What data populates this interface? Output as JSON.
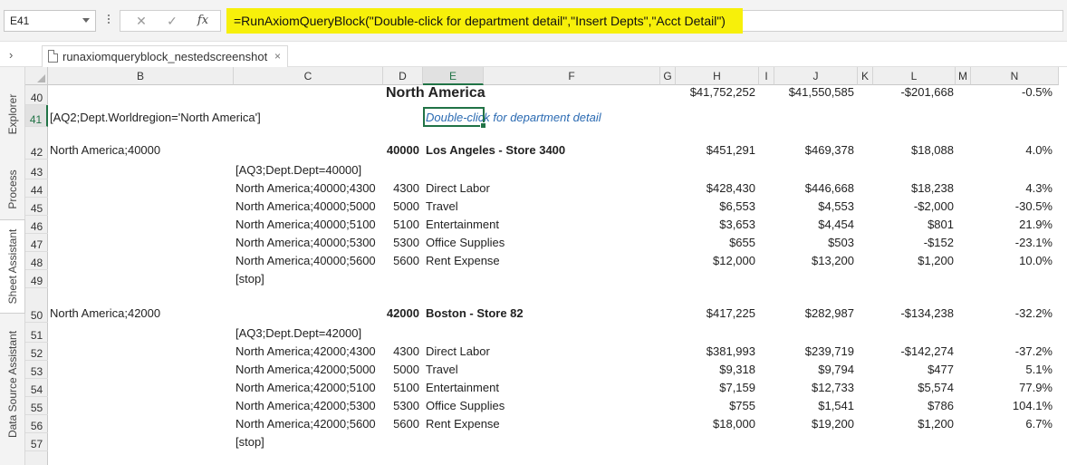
{
  "formula_bar": {
    "name_box": "E41",
    "cancel_glyph": "✕",
    "enter_glyph": "✓",
    "fx_label": "fx",
    "formula": "=RunAxiomQueryBlock(\"Double-click for department detail\",\"Insert Depts\",\"Acct Detail\")"
  },
  "tabs": {
    "nav_glyph": "›",
    "doc_tab_label": "runaxiomqueryblock_nestedscreenshot",
    "close_glyph": "×"
  },
  "side_panel": {
    "tabs": [
      "Explorer",
      "Process",
      "Sheet Assistant",
      "Data Source Assistant"
    ],
    "active": "Sheet Assistant"
  },
  "sheet": {
    "active_cell": "E41",
    "columns": [
      "B",
      "C",
      "D",
      "E",
      "F",
      "G",
      "H",
      "I",
      "J",
      "K",
      "L",
      "M",
      "N"
    ],
    "row_numbers": [
      "40",
      "41",
      "42",
      "43",
      "44",
      "45",
      "46",
      "47",
      "48",
      "49",
      "50",
      "51",
      "52",
      "53",
      "54",
      "55",
      "56",
      "57"
    ],
    "rows": [
      {
        "b": "",
        "c": "",
        "d": "",
        "f": "North America",
        "h": "$41,752,252",
        "j": "$41,550,585",
        "l": "-$201,668",
        "n": "-0.5%"
      },
      {
        "b": "[AQ2;Dept.Worldregion='North America']",
        "c": "",
        "d": "",
        "f": "Double-click for department detail",
        "h": "",
        "j": "",
        "l": "",
        "n": ""
      },
      {
        "b": "North America;40000",
        "c": "",
        "d": "40000",
        "f": "Los Angeles - Store 3400",
        "h": "$451,291",
        "j": "$469,378",
        "l": "$18,088",
        "n": "4.0%"
      },
      {
        "b": "",
        "c": "[AQ3;Dept.Dept=40000]",
        "d": "",
        "f": "",
        "h": "",
        "j": "",
        "l": "",
        "n": ""
      },
      {
        "b": "",
        "c": "North America;40000;4300",
        "d": "4300",
        "f": "Direct Labor",
        "h": "$428,430",
        "j": "$446,668",
        "l": "$18,238",
        "n": "4.3%"
      },
      {
        "b": "",
        "c": "North America;40000;5000",
        "d": "5000",
        "f": "Travel",
        "h": "$6,553",
        "j": "$4,553",
        "l": "-$2,000",
        "n": "-30.5%"
      },
      {
        "b": "",
        "c": "North America;40000;5100",
        "d": "5100",
        "f": "Entertainment",
        "h": "$3,653",
        "j": "$4,454",
        "l": "$801",
        "n": "21.9%"
      },
      {
        "b": "",
        "c": "North America;40000;5300",
        "d": "5300",
        "f": "Office Supplies",
        "h": "$655",
        "j": "$503",
        "l": "-$152",
        "n": "-23.1%"
      },
      {
        "b": "",
        "c": "North America;40000;5600",
        "d": "5600",
        "f": "Rent Expense",
        "h": "$12,000",
        "j": "$13,200",
        "l": "$1,200",
        "n": "10.0%"
      },
      {
        "b": "",
        "c": "[stop]",
        "d": "",
        "f": "",
        "h": "",
        "j": "",
        "l": "",
        "n": ""
      },
      {
        "b": "North America;42000",
        "c": "",
        "d": "42000",
        "f": "Boston - Store 82",
        "h": "$417,225",
        "j": "$282,987",
        "l": "-$134,238",
        "n": "-32.2%"
      },
      {
        "b": "",
        "c": "[AQ3;Dept.Dept=42000]",
        "d": "",
        "f": "",
        "h": "",
        "j": "",
        "l": "",
        "n": ""
      },
      {
        "b": "",
        "c": "North America;42000;4300",
        "d": "4300",
        "f": "Direct Labor",
        "h": "$381,993",
        "j": "$239,719",
        "l": "-$142,274",
        "n": "-37.2%"
      },
      {
        "b": "",
        "c": "North America;42000;5000",
        "d": "5000",
        "f": "Travel",
        "h": "$9,318",
        "j": "$9,794",
        "l": "$477",
        "n": "5.1%"
      },
      {
        "b": "",
        "c": "North America;42000;5100",
        "d": "5100",
        "f": "Entertainment",
        "h": "$7,159",
        "j": "$12,733",
        "l": "$5,574",
        "n": "77.9%"
      },
      {
        "b": "",
        "c": "North America;42000;5300",
        "d": "5300",
        "f": "Office Supplies",
        "h": "$755",
        "j": "$1,541",
        "l": "$786",
        "n": "104.1%"
      },
      {
        "b": "",
        "c": "North America;42000;5600",
        "d": "5600",
        "f": "Rent Expense",
        "h": "$18,000",
        "j": "$19,200",
        "l": "$1,200",
        "n": "6.7%"
      },
      {
        "b": "",
        "c": "[stop]",
        "d": "",
        "f": "",
        "h": "",
        "j": "",
        "l": "",
        "n": ""
      }
    ]
  }
}
